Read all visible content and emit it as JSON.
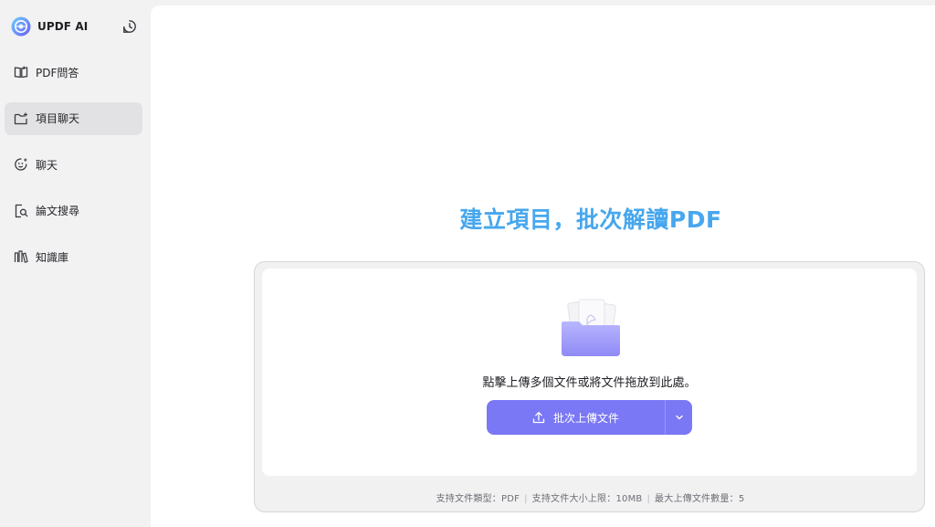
{
  "brand": {
    "name": "UPDF AI"
  },
  "sidebar": {
    "items": [
      {
        "label": "PDF問答",
        "icon": "book-icon",
        "active": false
      },
      {
        "label": "項目聊天",
        "icon": "folder-plus-icon",
        "active": true
      },
      {
        "label": "聊天",
        "icon": "chat-face-icon",
        "active": false
      },
      {
        "label": "論文搜尋",
        "icon": "document-search-icon",
        "active": false
      },
      {
        "label": "知識庫",
        "icon": "library-icon",
        "active": false
      }
    ]
  },
  "main": {
    "headline_prefix": "建立項目，批次解讀",
    "headline_suffix": "PDF",
    "drop_hint": "點擊上傳多個文件或將文件拖放到此處。",
    "upload_button": "批次上傳文件",
    "footnote": {
      "types": "支持文件類型：PDF",
      "size": "支持文件大小上限：10MB",
      "count": "最大上傳文件數量：5"
    }
  },
  "colors": {
    "accent": "#7a78f4",
    "headline": "#47a7ee",
    "active_nav": "#e2e2e4"
  }
}
